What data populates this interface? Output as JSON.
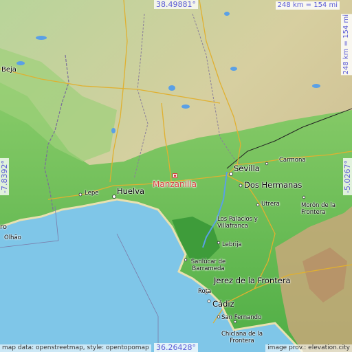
{
  "map": {
    "place_name": "Manzanilla",
    "coords": {
      "top": "38.49881°",
      "bottom": "36.26428°",
      "left": "-7.8392°",
      "right": "-5.0267°"
    },
    "scale": {
      "horizontal": "248 km = 154 mi",
      "vertical": "248 km = 154 mi"
    },
    "attribution_left": "map data: openstreetmap, style: opentopomap",
    "attribution_right": "image prov.: elevation.city",
    "places": {
      "beja": "Beja",
      "sevilla": "Sevilla",
      "carmona": "Carmona",
      "dos_hermanas": "Dos Hermanas",
      "lepe": "Lepe",
      "huelva": "Huelva",
      "faro": "ro",
      "olhao": "Olhão",
      "utrera": "Utrera",
      "moron": "Morón de la Frontera",
      "los_palacios": "Los Palacios y Villafranca",
      "lebrija": "Lebrija",
      "sanlucar": "Sanlúcar de Barrameda",
      "jerez": "Jerez de la Frontera",
      "rota": "Rota",
      "cadiz": "Cádiz",
      "san_fernando": "San Fernando",
      "chiclana": "Chiclana de la Frontera"
    },
    "colors": {
      "sea": "#7fc6e8",
      "lowland": "#5ab84a",
      "upland": "#c8c89a",
      "marker": "#d63c3c",
      "coord_text": "#5a5ad6"
    }
  }
}
